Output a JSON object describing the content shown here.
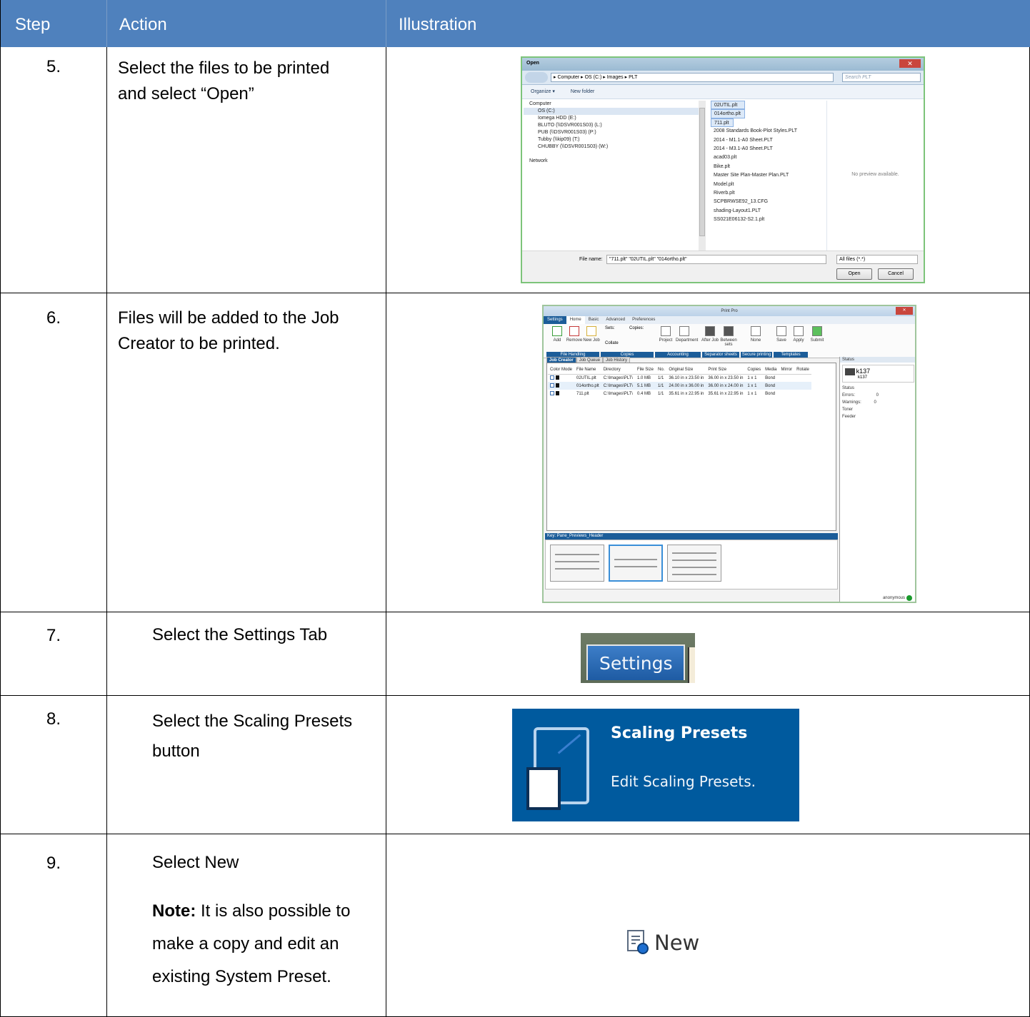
{
  "header": {
    "col1": "Step",
    "col2": "Action",
    "col3": "Illustration"
  },
  "rows": [
    {
      "step": "5.",
      "action_l1": "Select the files to be printed",
      "action_l2": "and select “Open”"
    },
    {
      "step": "6.",
      "action_l1": "Files will be added to the Job",
      "action_l2": "Creator to be printed."
    },
    {
      "step": "7.",
      "action": "Select the Settings Tab"
    },
    {
      "step": "8.",
      "action_l1": "Select the Scaling Presets",
      "action_l2": "button"
    },
    {
      "step": "9.",
      "action": "Select New",
      "note_label": "Note:",
      "note_l1": " It is also possible to",
      "note_l2": "make a copy and edit an",
      "note_l3": "existing System Preset."
    }
  ],
  "open_dialog": {
    "title": "Open",
    "path": "▸ Computer ▸ OS (C:) ▸ Images ▸ PLT",
    "search_placeholder": "Search PLT",
    "organize": "Organize ▾",
    "new_folder": "New folder",
    "nav": [
      "Computer",
      "OS (C:)",
      "Iomega HDD (E:)",
      "BLUTO (\\\\DSVR001S03) (L:)",
      "PUB (\\\\DSVR001S03) (P:)",
      "Tubby (\\\\kip09) (T:)",
      "CHUBBY (\\\\DSVR001S03) (W:)",
      "",
      "Network"
    ],
    "files": [
      "02UTIL.plt",
      "014ortho.plt",
      "711.plt",
      "2008 Standards Book-Plot Styles.PLT",
      "2014 - M1.1-A0 Sheet.PLT",
      "2014 - M3.1-A0 Sheet.PLT",
      "acad03.plt",
      "Bike.plt",
      "Master Site Plan-Master Plan.PLT",
      "Model.plt",
      "Riverb.plt",
      "SCPBRWSE92_13.CFG",
      "shading-Layout1.PLT",
      "SS021E06132-S2.1.plt"
    ],
    "preview": "No preview available.",
    "file_name_label": "File name:",
    "file_name_value": "\"711.plt\" \"02UTIL.plt\" \"014ortho.plt\"",
    "filter": "All files (*.*)",
    "open_btn": "Open",
    "cancel_btn": "Cancel"
  },
  "print_pro": {
    "title": "Print Pro",
    "tabs": [
      "Settings",
      "Home",
      "Basic",
      "Advanced",
      "Preferences"
    ],
    "ribbon_groups": [
      "File Handling",
      "Copies",
      "Accounting",
      "Separator sheets",
      "Secure printing",
      "Templates"
    ],
    "ribbon_buttons": [
      "Add",
      "Remove",
      "New Job",
      "Project",
      "Department",
      "After Job",
      "Between sets",
      "None",
      "Save",
      "Apply",
      "Submit"
    ],
    "sets_label": "Sets:",
    "copies_label": "Copies:",
    "collate": "Collate",
    "subtabs": [
      "Job Creator",
      "Job Queue",
      "Job History"
    ],
    "columns": [
      "Color Mode",
      "File Name",
      "Directory",
      "File Size",
      "No.",
      "Original Size",
      "Print Size",
      "Copies",
      "Media",
      "Mirror",
      "Rotate"
    ],
    "jobs": [
      [
        "02UTIL.plt",
        "C:\\Images\\PLT\\",
        "1.0 MB",
        "1/1",
        "36.10 in x 23.50 in",
        "36.00 in x 23.50 in",
        "1 x 1",
        "Bond"
      ],
      [
        "014ortho.plt",
        "C:\\Images\\PLT\\",
        "5.1 MB",
        "1/1",
        "24.00 in x 36.00 in",
        "36.00 in x 24.00 in",
        "1 x 1",
        "Bond"
      ],
      [
        "711.plt",
        "C:\\Images\\PLT\\",
        "0.4 MB",
        "1/1",
        "35.61 in x 22.95 in",
        "35.61 in x 22.95 in",
        "1 x 1",
        "Bond"
      ]
    ],
    "side_title": "Status",
    "printer": "k137",
    "printer_sub": "k137",
    "status_section": "Status",
    "errors_label": "Errors:",
    "errors": "0",
    "warnings_label": "Warnings:",
    "warnings": "0",
    "toner": "Toner",
    "feeder": "Feeder",
    "previews_header": "Key: Pane_Previews_Header",
    "user": "anonymous"
  },
  "settings_tab": {
    "label": "Settings"
  },
  "scaling": {
    "title": "Scaling Presets",
    "subtitle": "Edit Scaling Presets."
  },
  "new_button": {
    "label": "New"
  }
}
